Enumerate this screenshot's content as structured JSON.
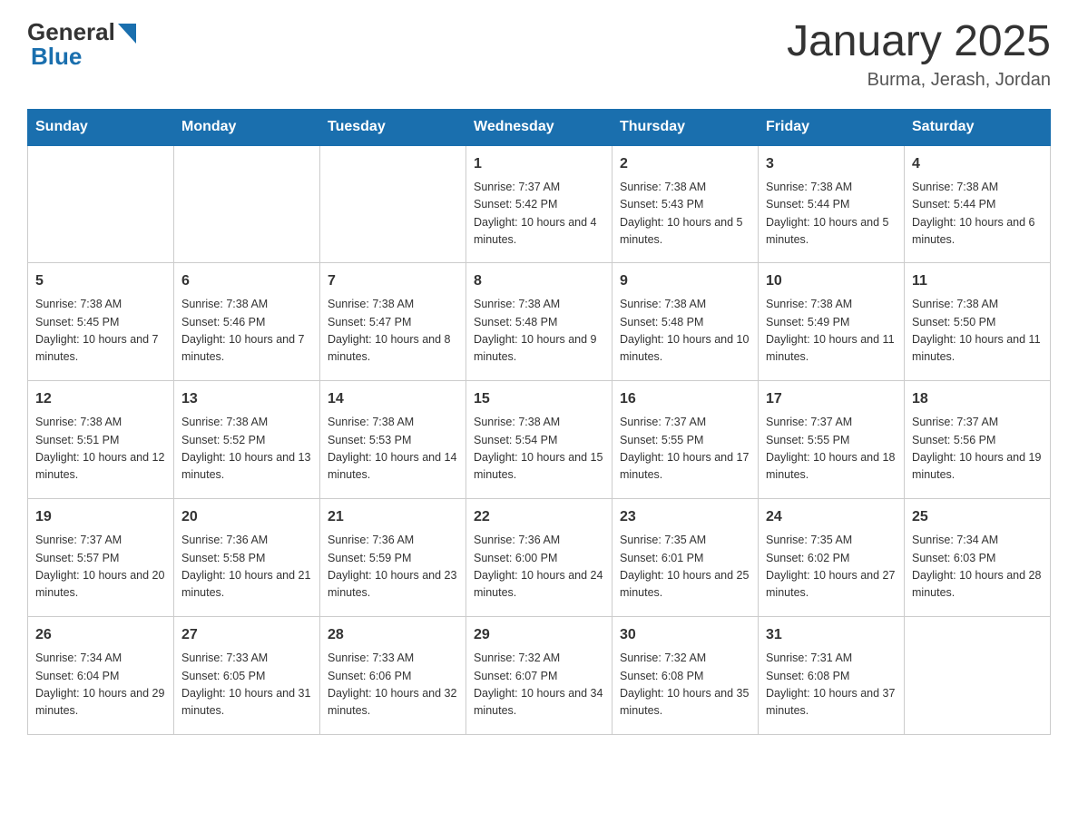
{
  "header": {
    "logo_general": "General",
    "logo_blue": "Blue",
    "title": "January 2025",
    "subtitle": "Burma, Jerash, Jordan"
  },
  "days_of_week": [
    "Sunday",
    "Monday",
    "Tuesday",
    "Wednesday",
    "Thursday",
    "Friday",
    "Saturday"
  ],
  "weeks": [
    [
      {
        "day": "",
        "info": ""
      },
      {
        "day": "",
        "info": ""
      },
      {
        "day": "",
        "info": ""
      },
      {
        "day": "1",
        "info": "Sunrise: 7:37 AM\nSunset: 5:42 PM\nDaylight: 10 hours and 4 minutes."
      },
      {
        "day": "2",
        "info": "Sunrise: 7:38 AM\nSunset: 5:43 PM\nDaylight: 10 hours and 5 minutes."
      },
      {
        "day": "3",
        "info": "Sunrise: 7:38 AM\nSunset: 5:44 PM\nDaylight: 10 hours and 5 minutes."
      },
      {
        "day": "4",
        "info": "Sunrise: 7:38 AM\nSunset: 5:44 PM\nDaylight: 10 hours and 6 minutes."
      }
    ],
    [
      {
        "day": "5",
        "info": "Sunrise: 7:38 AM\nSunset: 5:45 PM\nDaylight: 10 hours and 7 minutes."
      },
      {
        "day": "6",
        "info": "Sunrise: 7:38 AM\nSunset: 5:46 PM\nDaylight: 10 hours and 7 minutes."
      },
      {
        "day": "7",
        "info": "Sunrise: 7:38 AM\nSunset: 5:47 PM\nDaylight: 10 hours and 8 minutes."
      },
      {
        "day": "8",
        "info": "Sunrise: 7:38 AM\nSunset: 5:48 PM\nDaylight: 10 hours and 9 minutes."
      },
      {
        "day": "9",
        "info": "Sunrise: 7:38 AM\nSunset: 5:48 PM\nDaylight: 10 hours and 10 minutes."
      },
      {
        "day": "10",
        "info": "Sunrise: 7:38 AM\nSunset: 5:49 PM\nDaylight: 10 hours and 11 minutes."
      },
      {
        "day": "11",
        "info": "Sunrise: 7:38 AM\nSunset: 5:50 PM\nDaylight: 10 hours and 11 minutes."
      }
    ],
    [
      {
        "day": "12",
        "info": "Sunrise: 7:38 AM\nSunset: 5:51 PM\nDaylight: 10 hours and 12 minutes."
      },
      {
        "day": "13",
        "info": "Sunrise: 7:38 AM\nSunset: 5:52 PM\nDaylight: 10 hours and 13 minutes."
      },
      {
        "day": "14",
        "info": "Sunrise: 7:38 AM\nSunset: 5:53 PM\nDaylight: 10 hours and 14 minutes."
      },
      {
        "day": "15",
        "info": "Sunrise: 7:38 AM\nSunset: 5:54 PM\nDaylight: 10 hours and 15 minutes."
      },
      {
        "day": "16",
        "info": "Sunrise: 7:37 AM\nSunset: 5:55 PM\nDaylight: 10 hours and 17 minutes."
      },
      {
        "day": "17",
        "info": "Sunrise: 7:37 AM\nSunset: 5:55 PM\nDaylight: 10 hours and 18 minutes."
      },
      {
        "day": "18",
        "info": "Sunrise: 7:37 AM\nSunset: 5:56 PM\nDaylight: 10 hours and 19 minutes."
      }
    ],
    [
      {
        "day": "19",
        "info": "Sunrise: 7:37 AM\nSunset: 5:57 PM\nDaylight: 10 hours and 20 minutes."
      },
      {
        "day": "20",
        "info": "Sunrise: 7:36 AM\nSunset: 5:58 PM\nDaylight: 10 hours and 21 minutes."
      },
      {
        "day": "21",
        "info": "Sunrise: 7:36 AM\nSunset: 5:59 PM\nDaylight: 10 hours and 23 minutes."
      },
      {
        "day": "22",
        "info": "Sunrise: 7:36 AM\nSunset: 6:00 PM\nDaylight: 10 hours and 24 minutes."
      },
      {
        "day": "23",
        "info": "Sunrise: 7:35 AM\nSunset: 6:01 PM\nDaylight: 10 hours and 25 minutes."
      },
      {
        "day": "24",
        "info": "Sunrise: 7:35 AM\nSunset: 6:02 PM\nDaylight: 10 hours and 27 minutes."
      },
      {
        "day": "25",
        "info": "Sunrise: 7:34 AM\nSunset: 6:03 PM\nDaylight: 10 hours and 28 minutes."
      }
    ],
    [
      {
        "day": "26",
        "info": "Sunrise: 7:34 AM\nSunset: 6:04 PM\nDaylight: 10 hours and 29 minutes."
      },
      {
        "day": "27",
        "info": "Sunrise: 7:33 AM\nSunset: 6:05 PM\nDaylight: 10 hours and 31 minutes."
      },
      {
        "day": "28",
        "info": "Sunrise: 7:33 AM\nSunset: 6:06 PM\nDaylight: 10 hours and 32 minutes."
      },
      {
        "day": "29",
        "info": "Sunrise: 7:32 AM\nSunset: 6:07 PM\nDaylight: 10 hours and 34 minutes."
      },
      {
        "day": "30",
        "info": "Sunrise: 7:32 AM\nSunset: 6:08 PM\nDaylight: 10 hours and 35 minutes."
      },
      {
        "day": "31",
        "info": "Sunrise: 7:31 AM\nSunset: 6:08 PM\nDaylight: 10 hours and 37 minutes."
      },
      {
        "day": "",
        "info": ""
      }
    ]
  ]
}
